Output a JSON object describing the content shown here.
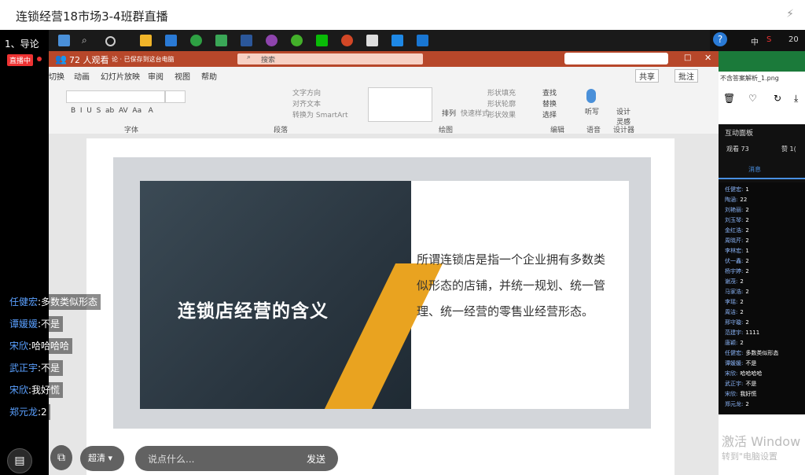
{
  "window": {
    "title": "连锁经营18市场3-4班群直播"
  },
  "lesson": {
    "name": "1、导论",
    "live_badge": "直播中"
  },
  "ppt": {
    "viewers": "72 人观看",
    "doc_status": "论 · 已保存到这台电脑",
    "search_placeholder": "搜索",
    "menus": [
      "切换",
      "动画",
      "幻灯片放映",
      "审阅",
      "视图",
      "帮助"
    ],
    "share": "共享",
    "comment": "批注",
    "groups": [
      "字体",
      "段落",
      "绘图",
      "编辑",
      "语音",
      "设计器"
    ],
    "ribbon_labels": {
      "text_dir": "文字方向",
      "align": "对齐文本",
      "smartart": "转换为 SmartArt",
      "arrange": "排列",
      "quick_style": "快速样式",
      "fill": "形状填充",
      "outline": "形状轮廓",
      "effect": "形状效果",
      "find": "查找",
      "replace": "替换",
      "select": "选择",
      "dictate": "听写",
      "design": "设计灵感"
    }
  },
  "slide": {
    "title": "连锁店经营的含义",
    "body": "所谓连锁店是指一个企业拥有多数类似形态的店铺，并统一规划、统一管理、统一经营的零售业经营形态。"
  },
  "right_panel": {
    "file": "不含答案解析_1.png",
    "board_title": "互动面板",
    "viewers_label": "观看 73",
    "likes_label": "赞 1(",
    "tab": "消息",
    "rows": [
      {
        "n": "任健宏:",
        "v": "1"
      },
      {
        "n": "陶涵:",
        "v": "22"
      },
      {
        "n": "刘艳丽:",
        "v": "2"
      },
      {
        "n": "刘玉琴:",
        "v": "2"
      },
      {
        "n": "金红浩:",
        "v": "2"
      },
      {
        "n": "周晓芹:",
        "v": "2"
      },
      {
        "n": "李林宏:",
        "v": "1"
      },
      {
        "n": "伏一鑫:",
        "v": "2"
      },
      {
        "n": "杨宇婷:",
        "v": "2"
      },
      {
        "n": "谢茂:",
        "v": "2"
      },
      {
        "n": "马家浩:",
        "v": "2"
      },
      {
        "n": "李瑶:",
        "v": "2"
      },
      {
        "n": "周洁:",
        "v": "2"
      },
      {
        "n": "邢守璇:",
        "v": "2"
      },
      {
        "n": "范建宇:",
        "v": "1111"
      },
      {
        "n": "唐颖:",
        "v": "2"
      },
      {
        "n": "任健宏:",
        "v": "多数类似形态"
      },
      {
        "n": "谭媛媛:",
        "v": "不是"
      },
      {
        "n": "宋欣:",
        "v": "哈哈哈哈"
      },
      {
        "n": "武正宇:",
        "v": "不是"
      },
      {
        "n": "宋欣:",
        "v": "我好慌"
      },
      {
        "n": "郑元龙:",
        "v": "2"
      }
    ],
    "activate": "激活 Window",
    "activate_sub": "转到\"电脑设置"
  },
  "chat": [
    {
      "name": "任健宏",
      "msg": ":多数类似形态"
    },
    {
      "name": "谭媛媛",
      "msg": ":不是"
    },
    {
      "name": "宋欣",
      "msg": ":哈哈哈哈"
    },
    {
      "name": "武正宇",
      "msg": ":不是"
    },
    {
      "name": "宋欣",
      "msg": ":我好慌"
    },
    {
      "name": "郑元龙",
      "msg": ":2"
    }
  ],
  "controls": {
    "quality": "超清",
    "input_placeholder": "说点什么...",
    "send": "发送"
  },
  "tray": {
    "ime": "中",
    "time": "20"
  }
}
